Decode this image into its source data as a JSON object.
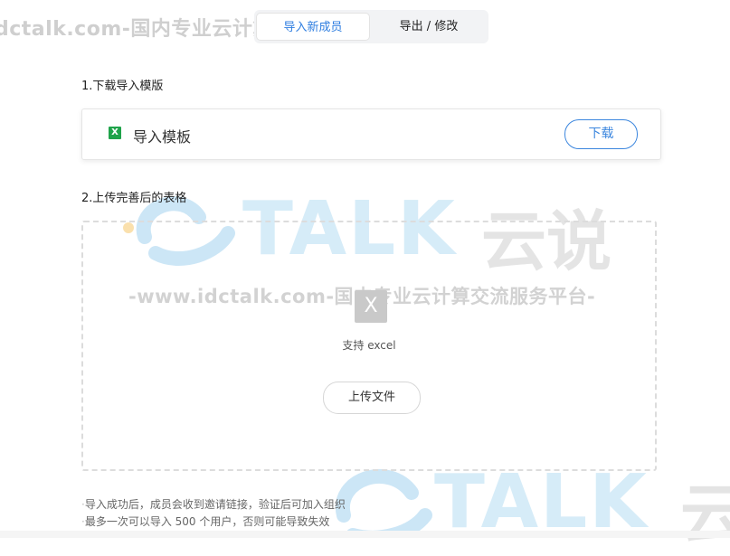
{
  "watermark": {
    "top_text": "dctalk.com-国内专业云计算交流服务平台",
    "url_text": "-www.idctalk.com-国内专业云计算交流服务平台-",
    "logo_tal": "TAL",
    "logo_k": "K",
    "logo_cn": "云说",
    "bottom_tal": "TAL",
    "bottom_k": "K",
    "bottom_cn": "云"
  },
  "tabs": [
    {
      "label": "导入新成员",
      "active": true
    },
    {
      "label": "导出 / 修改",
      "active": false
    }
  ],
  "step1": {
    "title": "1.下载导入模版",
    "template_icon": "X",
    "template_name": "导入模板",
    "download_label": "下载"
  },
  "step2": {
    "title": "2.上传完善后的表格",
    "file_icon": "X",
    "support_text": "支持 excel",
    "upload_label": "上传文件"
  },
  "notes": [
    "导入成功后，成员会收到邀请链接，验证后可加入组织",
    "最多一次可以导入 500 个用户，否则可能导致失效"
  ],
  "colors": {
    "accent": "#2f7ee0",
    "excel_green": "#1fa34a",
    "dashed_border": "#dcdcdc"
  }
}
